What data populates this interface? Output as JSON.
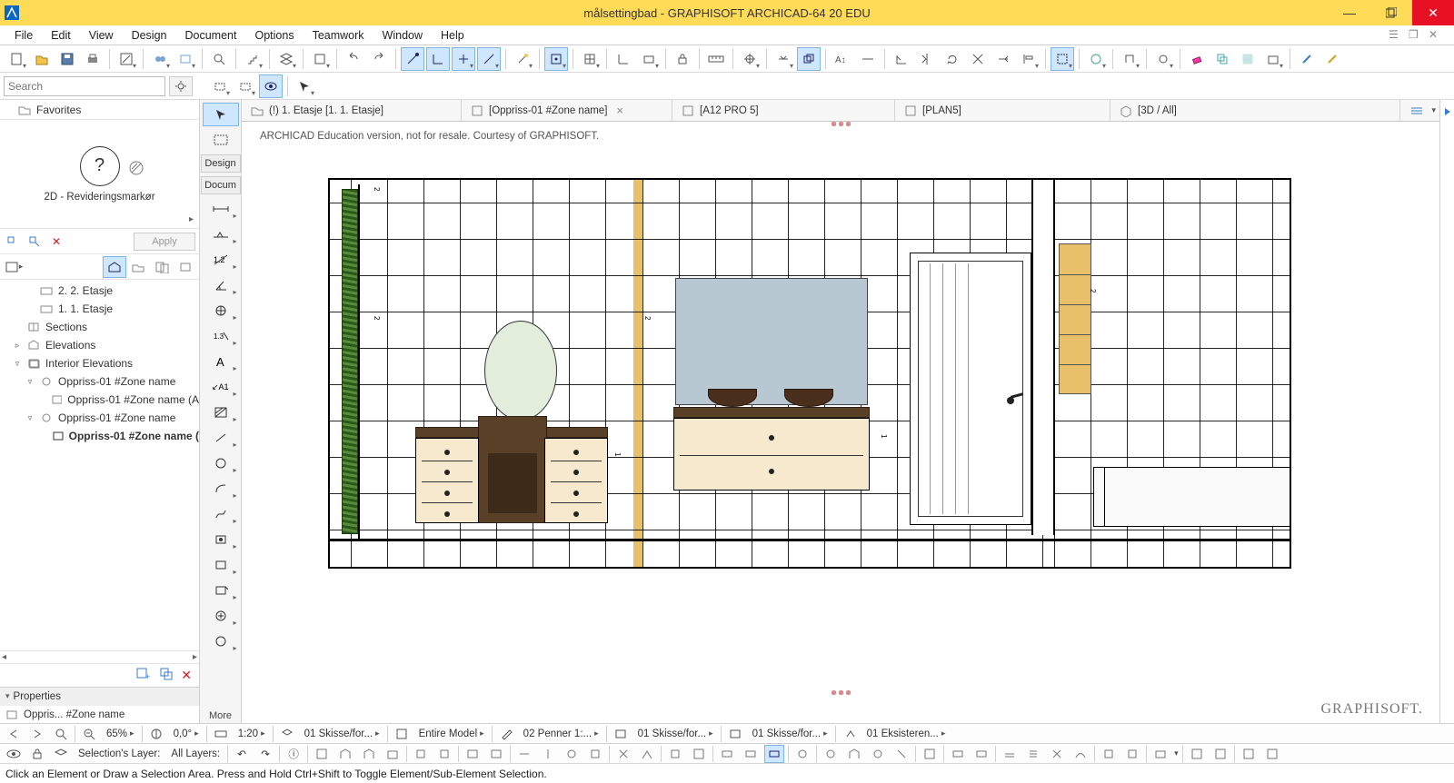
{
  "titlebar": {
    "title": "målsettingbad - GRAPHISOFT ARCHICAD-64 20 EDU"
  },
  "menu": {
    "items": [
      "File",
      "Edit",
      "View",
      "Design",
      "Document",
      "Options",
      "Teamwork",
      "Window",
      "Help"
    ]
  },
  "search": {
    "placeholder": "Search"
  },
  "favorites": {
    "label": "Favorites"
  },
  "question_panel": {
    "label": "2D - Revideringsmarkør"
  },
  "apply_row": {
    "apply": "Apply"
  },
  "nav": {
    "items": [
      {
        "depth": "d2",
        "label": "2. 2. Etasje"
      },
      {
        "depth": "d2",
        "label": "1. 1. Etasje"
      },
      {
        "depth": "d1",
        "label": "Sections",
        "tw": ""
      },
      {
        "depth": "d1",
        "label": "Elevations",
        "tw": "▹"
      },
      {
        "depth": "d1",
        "label": "Interior Elevations",
        "tw": "▿"
      },
      {
        "depth": "d2",
        "label": "Oppriss-01 #Zone name",
        "tw": "▿"
      },
      {
        "depth": "d3",
        "label": "Oppriss-01 #Zone name (A"
      },
      {
        "depth": "d2",
        "label": "Oppriss-01 #Zone name",
        "tw": "▿"
      },
      {
        "depth": "d3",
        "label": "Oppriss-01 #Zone name (",
        "bold": true
      }
    ]
  },
  "properties": {
    "header": "Properties",
    "row": "Oppris... #Zone name"
  },
  "toolstrip": {
    "design": "Design",
    "docum": "Docum",
    "more": "More"
  },
  "viewtabs": {
    "tabs": [
      {
        "label": "(!) 1. Etasje [1. 1. Etasje]",
        "closable": false
      },
      {
        "label": "[Oppriss-01 #Zone name]",
        "closable": true
      },
      {
        "label": "[A12 PRO 5]",
        "closable": false
      },
      {
        "label": "[PLAN5]",
        "closable": false
      },
      {
        "label": "[3D / All]",
        "closable": false
      }
    ]
  },
  "canvas": {
    "edu_note": "ARCHICAD Education version, not for resale. Courtesy of GRAPHISOFT.",
    "brand": "GRAPHISOFT."
  },
  "statusbar1": {
    "zoom_pct": "65%",
    "angle": "0,0°",
    "scale": "1:20",
    "combo1": "01 Skisse/for...",
    "combo2": "Entire Model",
    "combo3": "02 Penner 1:...",
    "combo4": "01 Skisse/for...",
    "combo5": "01 Skisse/for...",
    "combo6": "01 Eksisteren..."
  },
  "statusbar2": {
    "sel_layer_label": "Selection's Layer:",
    "all_layers": "All Layers:"
  },
  "statusmsg": {
    "text": "Click an Element or Draw a Selection Area. Press and Hold Ctrl+Shift to Toggle Element/Sub-Element Selection."
  }
}
